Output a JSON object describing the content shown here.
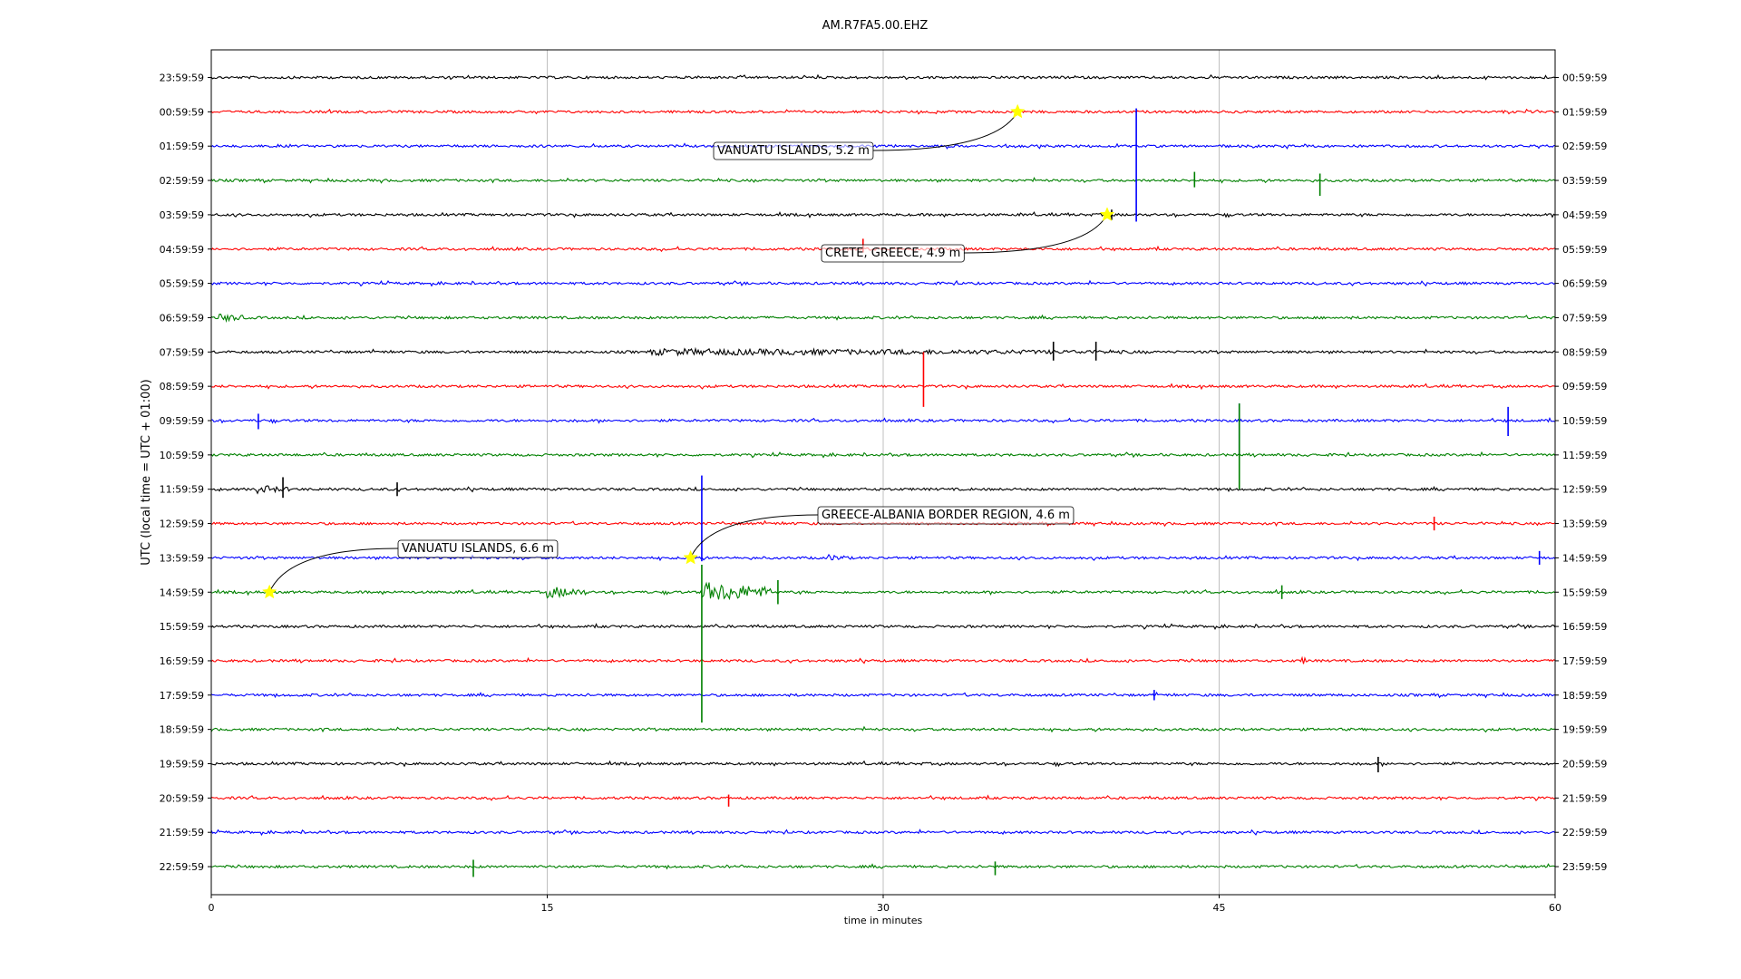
{
  "chart_data": {
    "type": "line",
    "title": "AM.R7FA5.00.EHZ",
    "xlabel": "time in minutes",
    "ylabel": "UTC (local time = UTC + 01:00)",
    "xlim": [
      0,
      60
    ],
    "x_ticks": [
      "0",
      "15",
      "30",
      "45",
      "60"
    ],
    "x_tick_values": [
      0,
      15,
      30,
      45,
      60
    ],
    "grid": "vertical lines at x ticks",
    "trace_colors": [
      "#000000",
      "#ff0000",
      "#0000ff",
      "#008000"
    ],
    "left_labels": [
      "23:59:59",
      "00:59:59",
      "01:59:59",
      "02:59:59",
      "03:59:59",
      "04:59:59",
      "05:59:59",
      "06:59:59",
      "07:59:59",
      "08:59:59",
      "09:59:59",
      "10:59:59",
      "11:59:59",
      "12:59:59",
      "13:59:59",
      "14:59:59",
      "15:59:59",
      "16:59:59",
      "17:59:59",
      "18:59:59",
      "19:59:59",
      "20:59:59",
      "21:59:59",
      "22:59:59"
    ],
    "right_labels": [
      "00:59:59",
      "01:59:59",
      "02:59:59",
      "03:59:59",
      "04:59:59",
      "05:59:59",
      "06:59:59",
      "07:59:59",
      "08:59:59",
      "09:59:59",
      "10:59:59",
      "11:59:59",
      "12:59:59",
      "13:59:59",
      "14:59:59",
      "15:59:59",
      "16:59:59",
      "17:59:59",
      "18:59:59",
      "19:59:59",
      "20:59:59",
      "21:59:59",
      "22:59:59",
      "23:59:59"
    ],
    "events": [
      {
        "label": "VANUATU ISLANDS, 5.2 m",
        "row": 1,
        "minute": 36.0,
        "marker": "star",
        "marker_color": "#ffff00"
      },
      {
        "label": "CRETE, GREECE, 4.9 m",
        "row": 4,
        "minute": 40.0,
        "marker": "star",
        "marker_color": "#ffff00"
      },
      {
        "label": "GREECE-ALBANIA BORDER REGION, 4.6 m",
        "row": 14,
        "minute": 21.4,
        "marker": "star",
        "marker_color": "#ffff00"
      },
      {
        "label": "VANUATU ISLANDS, 6.6 m",
        "row": 15,
        "minute": 2.6,
        "marker": "star",
        "marker_color": "#ffff00"
      }
    ],
    "spikes": [
      {
        "row": 2,
        "minute": 41.3,
        "up": 1.1,
        "down": 2.2
      },
      {
        "row": 3,
        "minute": 43.9,
        "up": 0.25,
        "down": 0.2
      },
      {
        "row": 3,
        "minute": 49.5,
        "up": 0.2,
        "down": 0.45
      },
      {
        "row": 4,
        "minute": 40.2,
        "up": 0.15,
        "down": 0.15
      },
      {
        "row": 5,
        "minute": 29.1,
        "up": 0.3,
        "down": 0.1
      },
      {
        "row": 8,
        "minute": 37.6,
        "up": 0.3,
        "down": 0.25
      },
      {
        "row": 8,
        "minute": 39.5,
        "up": 0.3,
        "down": 0.25
      },
      {
        "row": 9,
        "minute": 31.8,
        "up": 1.0,
        "down": 0.6
      },
      {
        "row": 10,
        "minute": 2.1,
        "up": 0.2,
        "down": 0.25
      },
      {
        "row": 10,
        "minute": 45.9,
        "up": 0.5,
        "down": 1.0
      },
      {
        "row": 10,
        "minute": 57.9,
        "up": 0.4,
        "down": 0.45
      },
      {
        "row": 11,
        "minute": 45.9,
        "up": 1.5,
        "down": 1.0
      },
      {
        "row": 12,
        "minute": 3.2,
        "up": 0.35,
        "down": 0.25
      },
      {
        "row": 12,
        "minute": 8.3,
        "up": 0.2,
        "down": 0.2
      },
      {
        "row": 13,
        "minute": 54.6,
        "up": 0.2,
        "down": 0.2
      },
      {
        "row": 14,
        "minute": 21.9,
        "up": 2.4,
        "down": 0.1
      },
      {
        "row": 14,
        "minute": 59.3,
        "up": 0.2,
        "down": 0.2
      },
      {
        "row": 15,
        "minute": 21.9,
        "up": 0.8,
        "down": 3.8
      },
      {
        "row": 15,
        "minute": 25.3,
        "up": 0.35,
        "down": 0.35
      },
      {
        "row": 15,
        "minute": 47.8,
        "up": 0.2,
        "down": 0.2
      },
      {
        "row": 18,
        "minute": 42.1,
        "up": 0.15,
        "down": 0.15
      },
      {
        "row": 20,
        "minute": 52.1,
        "up": 0.2,
        "down": 0.25
      },
      {
        "row": 21,
        "minute": 23.1,
        "up": 0.1,
        "down": 0.25
      },
      {
        "row": 23,
        "minute": 11.7,
        "up": 0.2,
        "down": 0.3
      },
      {
        "row": 23,
        "minute": 35.0,
        "up": 0.15,
        "down": 0.25
      }
    ],
    "bursts": [
      {
        "row": 7,
        "start": 0.3,
        "end": 1.6,
        "amp": 0.25
      },
      {
        "row": 8,
        "start": 19.5,
        "end": 41.5,
        "amp": 0.2
      },
      {
        "row": 12,
        "start": 2.0,
        "end": 3.5,
        "amp": 0.25
      },
      {
        "row": 14,
        "start": 27.5,
        "end": 28.6,
        "amp": 0.2
      },
      {
        "row": 15,
        "start": 15.0,
        "end": 16.8,
        "amp": 0.35
      },
      {
        "row": 15,
        "start": 21.9,
        "end": 25.0,
        "amp": 0.6
      },
      {
        "row": 17,
        "start": 48.6,
        "end": 49.0,
        "amp": 0.25
      }
    ]
  }
}
